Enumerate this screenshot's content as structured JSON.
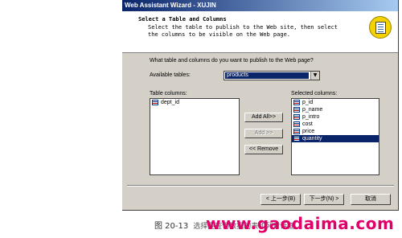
{
  "window": {
    "title": "Web Assistant Wizard - XUJIN"
  },
  "header": {
    "title": "Select a Table and Columns",
    "description": "Select the table to publish to the Web site, then select the columns to be visible on the Web page."
  },
  "prompt": "What table and columns do you want to publish to the Web page?",
  "available_tables": {
    "label": "Available tables:",
    "value": "products"
  },
  "table_columns": {
    "label": "Table columns:",
    "items": [
      "dept_id"
    ]
  },
  "selected_columns": {
    "label": "Selected columns:",
    "items": [
      "p_id",
      "p_name",
      "p_intro",
      "cost",
      "price",
      "quantity"
    ],
    "selected_index": 5
  },
  "buttons": {
    "add_all": "Add All>>",
    "add": "Add >>",
    "remove": "<< Remove",
    "back": "< 上一步(B)",
    "next": "下一步(N) >",
    "cancel": "取消"
  },
  "caption": {
    "figure": "图 20-13",
    "text": "选择要查询数据的表和列对话框"
  },
  "watermark": "www.gaodaima.com"
}
